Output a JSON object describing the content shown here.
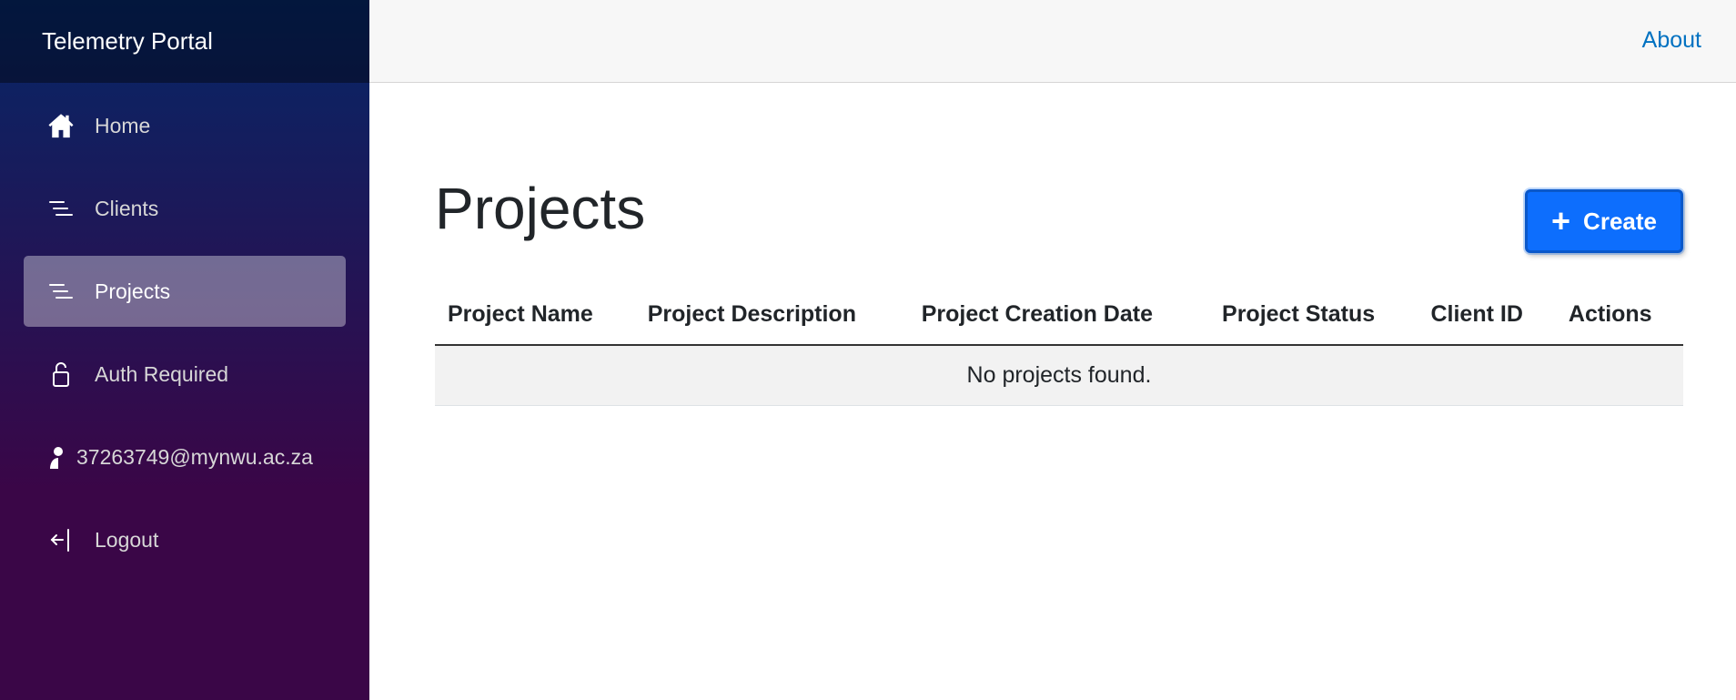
{
  "brand": "Telemetry Portal",
  "topbar": {
    "about": "About"
  },
  "nav": {
    "items": [
      {
        "label": "Home",
        "icon": "home-icon"
      },
      {
        "label": "Clients",
        "icon": "list-icon"
      },
      {
        "label": "Projects",
        "icon": "list-icon",
        "active": true
      },
      {
        "label": "Auth Required",
        "icon": "lock-icon"
      },
      {
        "label": "37263749@mynwu.ac.za",
        "icon": "person-icon"
      },
      {
        "label": "Logout",
        "icon": "logout-icon"
      }
    ]
  },
  "main": {
    "title": "Projects",
    "create_button": "Create",
    "table": {
      "headers": [
        "Project Name",
        "Project Description",
        "Project Creation Date",
        "Project Status",
        "Client ID",
        "Actions"
      ],
      "empty_message": "No projects found."
    }
  },
  "colors": {
    "primary": "#0d6efd",
    "sidebar_top": "#052767",
    "sidebar_bottom": "#3a0647",
    "link": "#0071c1"
  }
}
